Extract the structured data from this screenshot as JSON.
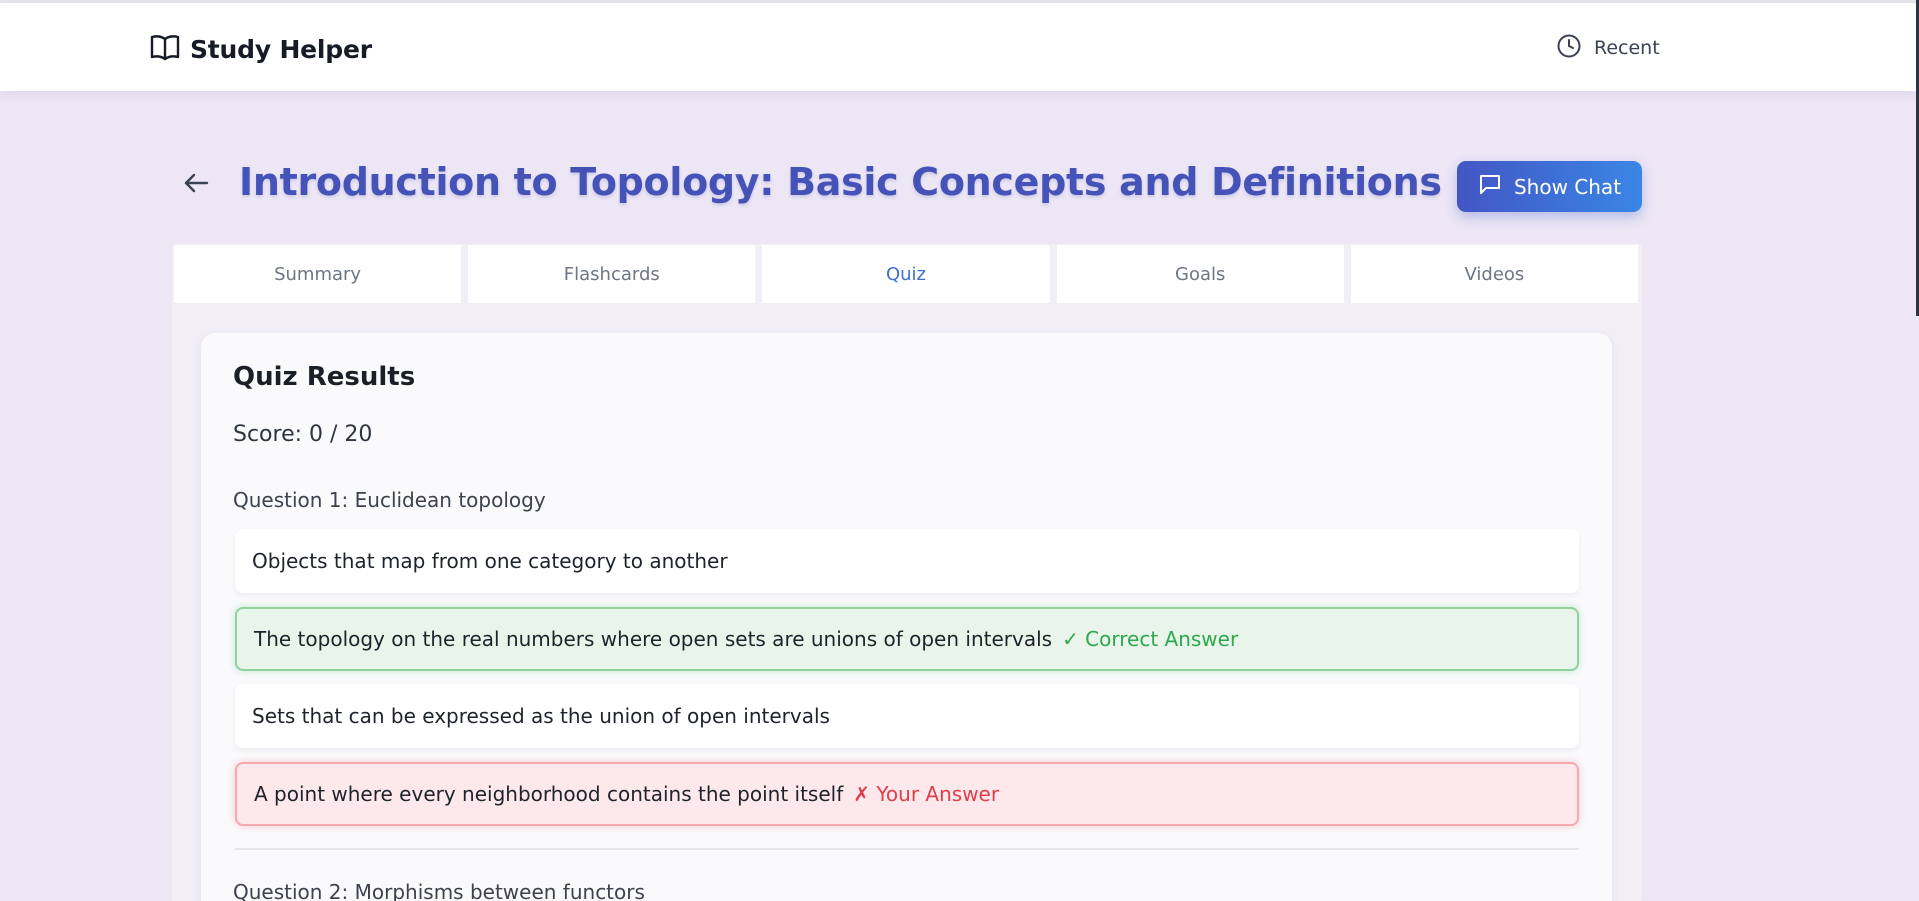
{
  "header": {
    "brand": "Study Helper",
    "brand_icon": "book-open-icon",
    "recent_label": "Recent",
    "recent_icon": "clock-icon"
  },
  "page": {
    "title": "Introduction to Topology: Basic Concepts and Definitions",
    "back_icon": "arrow-left-icon",
    "chat_button_label": "Show Chat",
    "chat_icon": "chat-bubble-icon"
  },
  "tabs": [
    {
      "label": "Summary",
      "active": false
    },
    {
      "label": "Flashcards",
      "active": false
    },
    {
      "label": "Quiz",
      "active": true
    },
    {
      "label": "Goals",
      "active": false
    },
    {
      "label": "Videos",
      "active": false
    }
  ],
  "quiz": {
    "heading": "Quiz Results",
    "score": "Score: 0 / 20",
    "questions": [
      {
        "prompt": "Question 1: Euclidean topology",
        "options": [
          {
            "text": "Objects that map from one category to another",
            "status": "none"
          },
          {
            "text": "The topology on the real numbers where open sets are unions of open intervals",
            "status": "correct",
            "tag": "✓ Correct Answer"
          },
          {
            "text": "Sets that can be expressed as the union of open intervals",
            "status": "none"
          },
          {
            "text": "A point where every neighborhood contains the point itself",
            "status": "wrong",
            "tag": "✗ Your Answer"
          }
        ]
      },
      {
        "prompt": "Question 2: Morphisms between functors"
      }
    ]
  },
  "colors": {
    "accent": "#4553b8",
    "active_tab": "#3f6fd1",
    "correct": "#2ea84f",
    "wrong": "#e03d4b",
    "background": "#ece6f5"
  }
}
